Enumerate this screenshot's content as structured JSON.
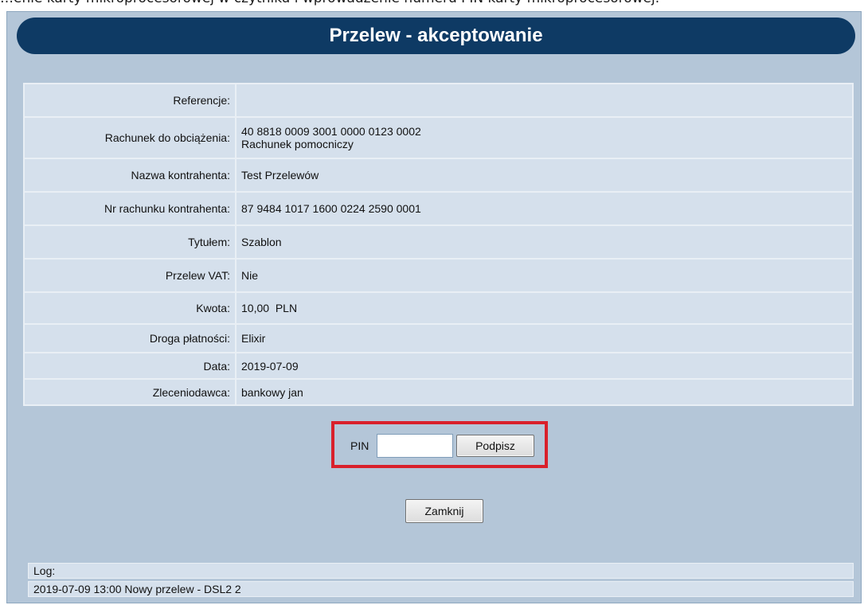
{
  "caption": "…enie karty mikroprocesorowej w czytniku i wprowadzenie numeru PIN karty mikroprocesorowej.",
  "title": "Przelew - akceptowanie",
  "details": {
    "rows": [
      {
        "label": "Referencje:",
        "value": "",
        "value2": ""
      },
      {
        "label": "Rachunek do obciążenia:",
        "value": "40 8818 0009 3001 0000 0123 0002",
        "value2": "Rachunek pomocniczy"
      },
      {
        "label": "Nazwa kontrahenta:",
        "value": "Test Przelewów",
        "value2": ""
      },
      {
        "label": "Nr rachunku kontrahenta:",
        "value": "87 9484 1017 1600 0224 2590 0001",
        "value2": ""
      },
      {
        "label": "Tytułem:",
        "value": "Szablon",
        "value2": ""
      },
      {
        "label": "Przelew VAT:",
        "value": "Nie",
        "value2": ""
      },
      {
        "label": "Kwota:",
        "value": "10,00  PLN",
        "value2": ""
      },
      {
        "label": "Droga płatności:",
        "value": "Elixir",
        "value2": ""
      },
      {
        "label": "Data:",
        "value": "2019-07-09",
        "value2": ""
      },
      {
        "label": "Zleceniodawca:",
        "value": "bankowy jan",
        "value2": ""
      }
    ]
  },
  "pin": {
    "label": "PIN",
    "value": "",
    "sign_button": "Podpisz"
  },
  "close_button": "Zamknij",
  "log": {
    "label": "Log:",
    "entry": "2019-07-09 13:00 Nowy przelew - DSL2 2"
  },
  "colors": {
    "title_bar": "#0e3a64",
    "panel_bg": "#b4c6d8",
    "row_bg": "#d5e0ec",
    "highlight_border": "#d9202b"
  }
}
